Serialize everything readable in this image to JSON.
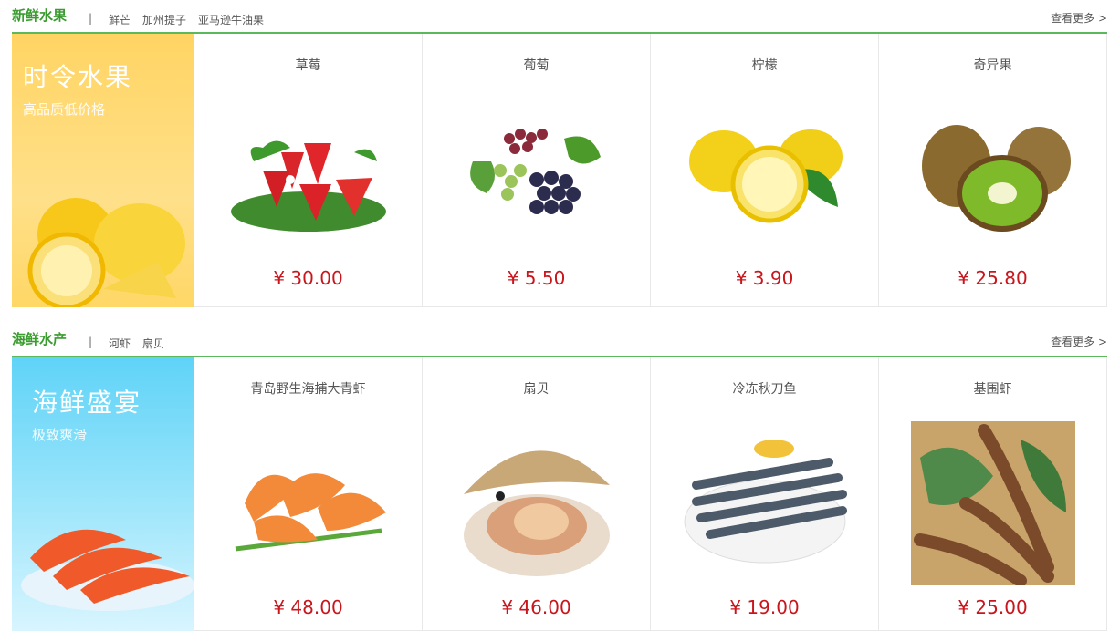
{
  "sections": [
    {
      "title": "新鲜水果",
      "separator": "|",
      "tags": [
        "鲜芒",
        "加州提子",
        "亚马逊牛油果"
      ],
      "more": "查看更多 >",
      "banner": {
        "title": "时令水果",
        "subtitle": "高品质低价格"
      },
      "products": [
        {
          "name": "草莓",
          "price": "¥ 30.00",
          "icon": "strawberry-image"
        },
        {
          "name": "葡萄",
          "price": "¥ 5.50",
          "icon": "grapes-image"
        },
        {
          "name": "柠檬",
          "price": "¥ 3.90",
          "icon": "lemon-image"
        },
        {
          "name": "奇异果",
          "price": "¥ 25.80",
          "icon": "kiwi-image"
        }
      ]
    },
    {
      "title": "海鲜水产",
      "separator": "|",
      "tags": [
        "河虾",
        "扇贝"
      ],
      "more": "查看更多 >",
      "banner": {
        "title": "海鲜盛宴",
        "subtitle": "极致爽滑"
      },
      "products": [
        {
          "name": "青岛野生海捕大青虾",
          "price": "¥ 48.00",
          "icon": "shrimp-image"
        },
        {
          "name": "扇贝",
          "price": "¥ 46.00",
          "icon": "scallop-image"
        },
        {
          "name": "冷冻秋刀鱼",
          "price": "¥ 19.00",
          "icon": "saury-image"
        },
        {
          "name": "基围虾",
          "price": "¥ 25.00",
          "icon": "prawn-image"
        }
      ]
    }
  ],
  "colors": {
    "accent": "#3a9c2f",
    "price": "#c8161d",
    "fruit_banner": "#ffd463",
    "sea_banner": "#5fd3f7"
  }
}
